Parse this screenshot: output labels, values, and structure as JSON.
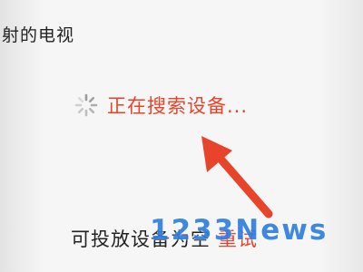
{
  "header": {
    "title": "投射的电视"
  },
  "search": {
    "status_text": "正在搜索设备..."
  },
  "footer": {
    "label": "可投放设备为空",
    "retry_label": "重试"
  },
  "watermark": {
    "text": "1233News"
  },
  "colors": {
    "accent_red": "#e8432b",
    "text_dark": "#222222",
    "spinner_gray": "#9a9a9a",
    "watermark_blue": "#2f7fe0"
  },
  "icons": [
    "loading-spinner-icon",
    "annotation-arrow-icon"
  ]
}
